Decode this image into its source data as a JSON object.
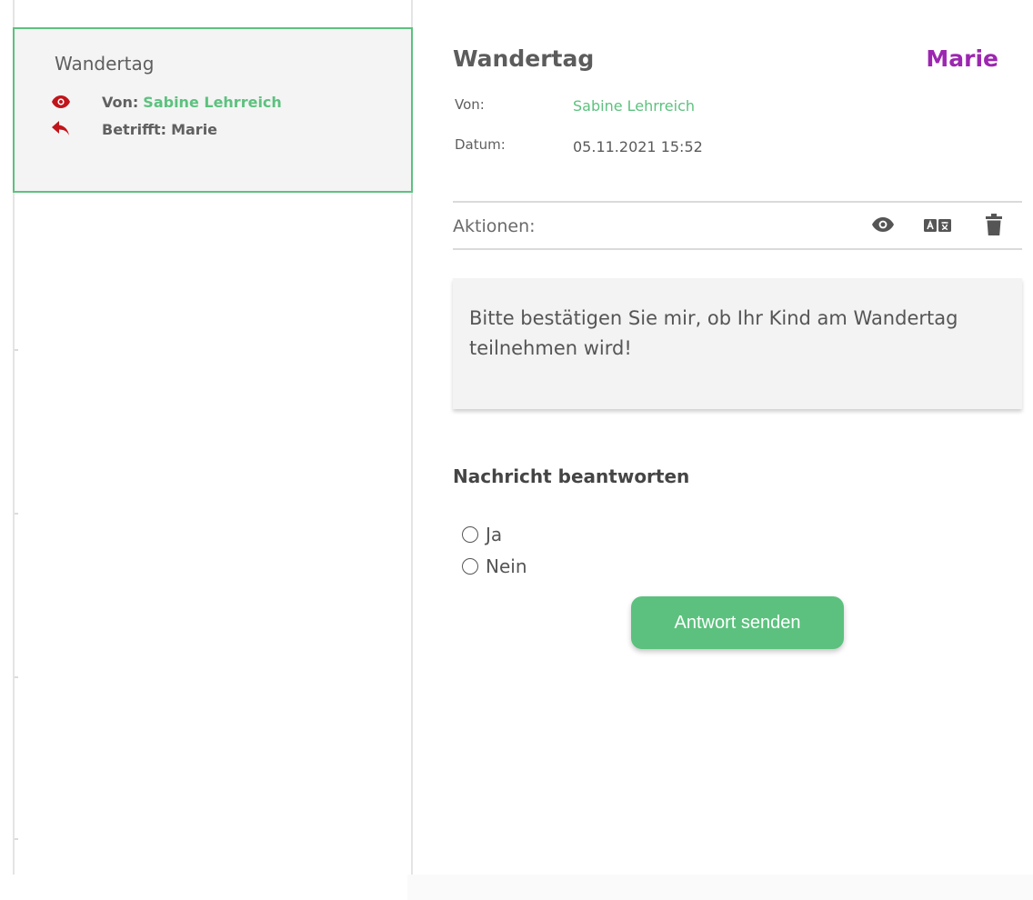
{
  "message_list": {
    "items": [
      {
        "title": "Wandertag",
        "from_label": "Von:",
        "from_name": "Sabine Lehrreich",
        "regarding_label": "Betrifft:",
        "regarding_name": "Marie",
        "icons": [
          "eye-icon",
          "reply-icon"
        ],
        "selected": true
      }
    ]
  },
  "detail": {
    "title": "Wandertag",
    "recipient": "Marie",
    "from_label": "Von:",
    "from_value": "Sabine Lehrreich",
    "date_label": "Datum:",
    "date_value": "05.11.2021 15:52",
    "actions_label": "Aktionen:",
    "actions": [
      "eye-icon",
      "translate-icon",
      "trash-icon"
    ],
    "message": "Bitte bestätigen Sie mir, ob Ihr Kind am Wandertag teilnehmen wird!"
  },
  "reply": {
    "heading": "Nachricht beantworten",
    "options": [
      "Ja",
      "Nein"
    ],
    "submit_label": "Antwort senden"
  },
  "colors": {
    "accent_green": "#5dc17f",
    "recipient_purple": "#9c27b0",
    "icon_red": "#c0151b",
    "icon_dark": "#555555"
  }
}
